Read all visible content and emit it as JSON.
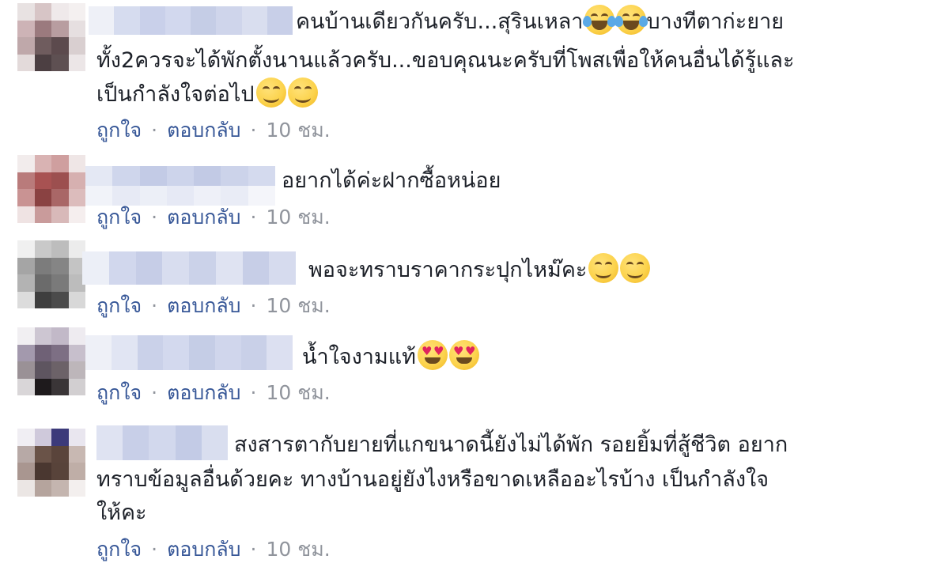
{
  "comments": [
    {
      "text_lines": [
        "คนบ้านเดียวกันครับ...สุรินเหลา",
        "บางทีตาก่ะยาย",
        "ทั้ง2ควรจะได้พักตั้งนานแล้วครับ...ขอบคุณนะครับที่โพสเพื่อให้คนอื่นได้รู้และ",
        "เป็นกำลังใจต่อไป"
      ],
      "emojis": [
        "face-with-tears-of-joy",
        "face-with-tears-of-joy",
        "smiling-face",
        "smiling-face"
      ],
      "like": "ถูกใจ",
      "reply": "ตอบกลับ",
      "time": "10 ชม."
    },
    {
      "text_lines": [
        "อยากได้ค่ะฝากซื้อหน่อย"
      ],
      "emojis": [],
      "like": "ถูกใจ",
      "reply": "ตอบกลับ",
      "time": "10 ชม."
    },
    {
      "text_lines": [
        "พอจะทราบราคากระปุกไหม๊คะ"
      ],
      "emojis": [
        "smiling-face",
        "smiling-face"
      ],
      "like": "ถูกใจ",
      "reply": "ตอบกลับ",
      "time": "10 ชม."
    },
    {
      "text_lines": [
        "น้ำใจงามแท้"
      ],
      "emojis": [
        "heart-eyes-face",
        "heart-eyes-face"
      ],
      "like": "ถูกใจ",
      "reply": "ตอบกลับ",
      "time": "10 ชม."
    },
    {
      "text_lines": [
        "สงสารตากับยายที่แกขนาดนี้ยังไม่ได้พัก รอยยิ้มที่สู้ชีวิต อยาก",
        "ทราบข้อมูลอื่นด้วยคะ ทางบ้านอยู่ยังไงหรือขาดเหลืออะไรบ้าง เป็นกำลังใจ",
        "ให้คะ"
      ],
      "emojis": [],
      "like": "ถูกใจ",
      "reply": "ตอบกลับ",
      "time": "10 ชม."
    }
  ],
  "colors": {
    "link": "#385898",
    "meta": "#90949c",
    "text": "#1d2129",
    "name_blur": "#c5cde6"
  }
}
